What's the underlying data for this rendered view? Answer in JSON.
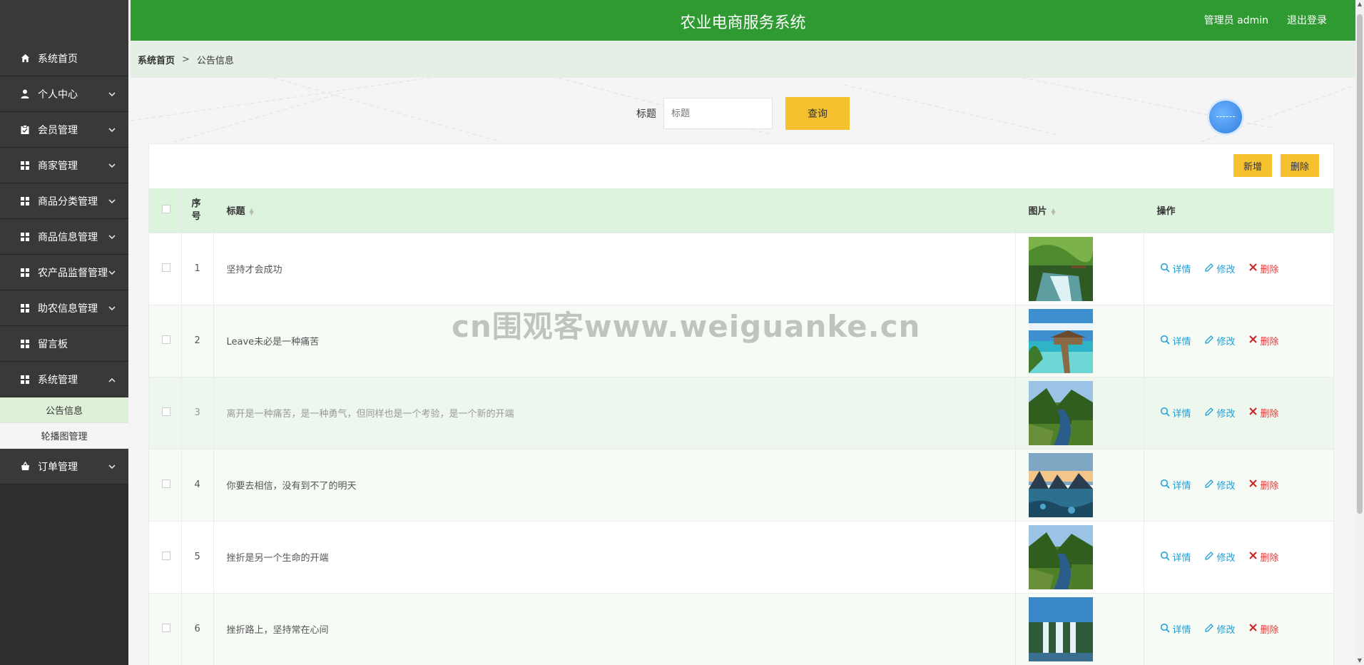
{
  "header": {
    "title": "农业电商服务系统",
    "user": "管理员 admin",
    "logout": "退出登录"
  },
  "breadcrumb": {
    "home": "系统首页",
    "sep": ">",
    "current": "公告信息"
  },
  "sidebar": {
    "items": [
      {
        "label": "系统首页",
        "icon": "home-icon",
        "chevron": ""
      },
      {
        "label": "个人中心",
        "icon": "user-icon",
        "chevron": "⌄"
      },
      {
        "label": "会员管理",
        "icon": "clipboard-icon",
        "chevron": "⌄"
      },
      {
        "label": "商家管理",
        "icon": "grid-icon",
        "chevron": "⌄"
      },
      {
        "label": "商品分类管理",
        "icon": "grid-icon",
        "chevron": "⌄"
      },
      {
        "label": "商品信息管理",
        "icon": "grid-icon",
        "chevron": "⌄"
      },
      {
        "label": "农产品监督管理",
        "icon": "grid-icon",
        "chevron": "⌄"
      },
      {
        "label": "助农信息管理",
        "icon": "grid-icon",
        "chevron": "⌄"
      },
      {
        "label": "留言板",
        "icon": "grid-icon",
        "chevron": ""
      },
      {
        "label": "系统管理",
        "icon": "grid-icon",
        "chevron": "⌃"
      },
      {
        "label": "订单管理",
        "icon": "cart-icon",
        "chevron": "⌄"
      }
    ],
    "sub": [
      {
        "label": "公告信息",
        "active": true
      },
      {
        "label": "轮播图管理",
        "active": false
      }
    ]
  },
  "search": {
    "label": "标题",
    "placeholder": "标题",
    "button": "查询"
  },
  "toolbar": {
    "add": "新增",
    "delete": "删除"
  },
  "table": {
    "headers": {
      "index": "序号",
      "title": "标题",
      "image": "图片",
      "ops": "操作"
    },
    "rows": [
      {
        "index": "1",
        "title": "坚持才会成功",
        "img": "forest-waterfall"
      },
      {
        "index": "2",
        "title": "Leave未必是一种痛苦",
        "img": "ocean-pier"
      },
      {
        "index": "3",
        "title": "离开是一种痛苦，是一种勇气，但同样也是一个考验，是一个新的开端",
        "img": "forest-river"
      },
      {
        "index": "4",
        "title": "你要去相信，没有到不了的明天",
        "img": "mountain-lake"
      },
      {
        "index": "5",
        "title": "挫折是另一个生命的开端",
        "img": "forest-river"
      },
      {
        "index": "6",
        "title": "挫折路上，坚持常在心间",
        "img": "waterfall"
      }
    ],
    "ops": {
      "detail": "详情",
      "edit": "修改",
      "delete": "删除"
    }
  },
  "watermark": "cn围观客www.weiguanke.cn",
  "colors": {
    "header": "#2e9a31",
    "sidebar": "#393939",
    "accent": "#f5c12e",
    "tableHead": "#ddf3dd",
    "link": "#1e9fd6",
    "danger": "#e23b3b"
  }
}
